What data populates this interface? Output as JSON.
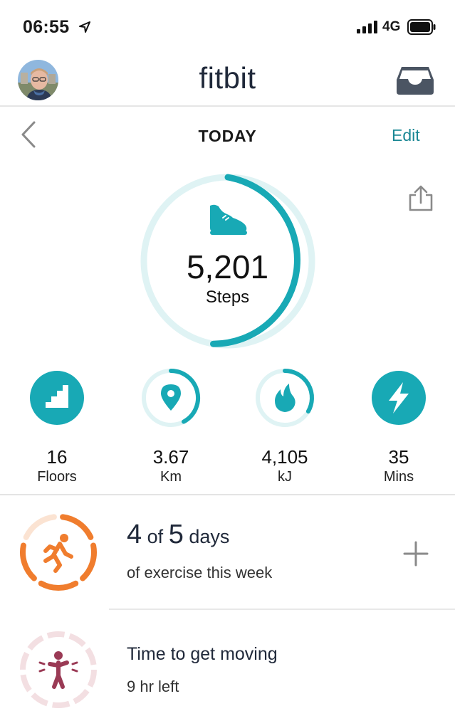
{
  "status_bar": {
    "time": "06:55",
    "network": "4G"
  },
  "header": {
    "brand": "fitbit"
  },
  "date_nav": {
    "title": "TODAY",
    "edit": "Edit"
  },
  "steps": {
    "value": "5,201",
    "label": "Steps"
  },
  "stats": [
    {
      "value": "16",
      "unit": "Floors",
      "icon": "stairs-icon"
    },
    {
      "value": "3.67",
      "unit": "Km",
      "icon": "location-pin-icon"
    },
    {
      "value": "4,105",
      "unit": "kJ",
      "icon": "flame-icon"
    },
    {
      "value": "35",
      "unit": "Mins",
      "icon": "lightning-icon"
    }
  ],
  "exercise": {
    "count": "4",
    "of_label": "of",
    "total": "5",
    "unit": "days",
    "subtitle": "of exercise this week",
    "days_completed": 4,
    "days_goal": 5
  },
  "hourly": {
    "title": "Time to get moving",
    "subtitle": "9 hr left"
  },
  "colors": {
    "teal": "#18a9b5",
    "teal_light": "#dff3f4",
    "brand_dark": "#20293a",
    "edit_teal": "#1a8794",
    "exercise_orange": "#f07d2e",
    "hourly_maroon": "#9a3a55",
    "hourly_ring": "#f3dfe2"
  }
}
